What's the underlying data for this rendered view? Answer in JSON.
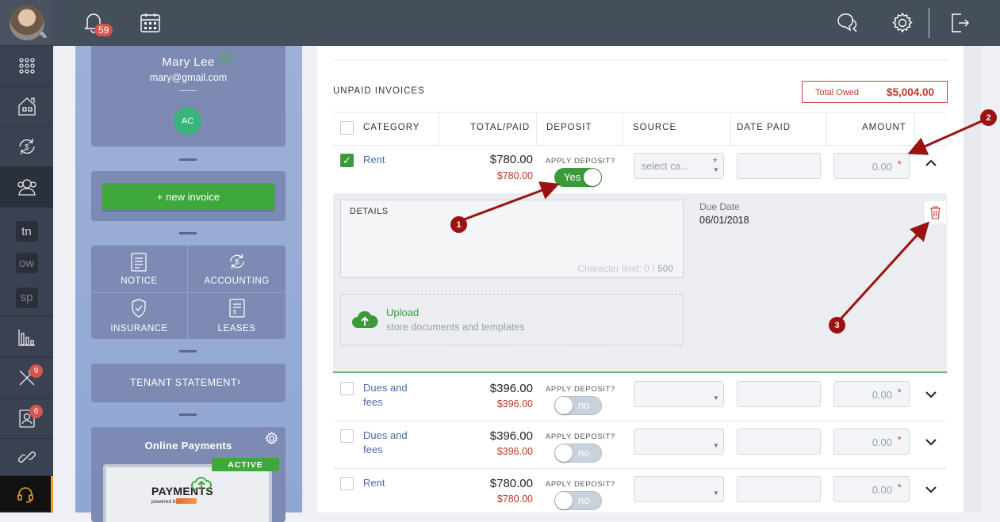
{
  "topbar": {
    "notification_count": "59"
  },
  "rail": {
    "labels": [
      "tn",
      "ow",
      "sp"
    ],
    "badges": {
      "tools": "9",
      "contacts": "6"
    }
  },
  "profile": {
    "name": "Mary Lee",
    "email": "mary@gmail.com",
    "initials": "AC"
  },
  "sidebar": {
    "new_invoice_label": "+ new invoice",
    "quick_links": [
      "NOTICE",
      "ACCOUNTING",
      "INSURANCE",
      "LEASES"
    ],
    "tenant_statement_label": "TENANT STATEMENT",
    "online_payments_title": "Online Payments",
    "active_badge": "ACTIVE",
    "payments_logo_text": "PAYMENTS",
    "payments_powered_by": "powered by"
  },
  "invoices": {
    "section_title": "UNPAID INVOICES",
    "total_owed_label": "Total Owed",
    "total_owed_value": "$5,004.00",
    "columns": [
      "CATEGORY",
      "TOTAL/PAID",
      "DEPOSIT",
      "SOURCE",
      "DATE PAID",
      "AMOUNT"
    ],
    "apply_deposit_label": "APPLY DEPOSIT?",
    "rows": [
      {
        "category": "Rent",
        "total": "$780.00",
        "paid": "$780.00",
        "deposit": "Yes",
        "source_placeholder": "select ca...",
        "amount_placeholder": "0.00",
        "checked": true,
        "expanded": true
      },
      {
        "category": "Dues and fees",
        "total": "$396.00",
        "paid": "$396.00",
        "deposit": "no",
        "amount_placeholder": "0.00",
        "checked": false
      },
      {
        "category": "Dues and fees",
        "total": "$396.00",
        "paid": "$396.00",
        "deposit": "no",
        "amount_placeholder": "0.00",
        "checked": false
      },
      {
        "category": "Rent",
        "total": "$780.00",
        "paid": "$780.00",
        "deposit": "no",
        "amount_placeholder": "0.00",
        "checked": false
      }
    ],
    "details": {
      "label": "DETAILS",
      "char_limit_prefix": "Character limit: 0 / ",
      "char_limit_max": "500",
      "due_date_label": "Due Date",
      "due_date_value": "06/01/2018",
      "upload_title": "Upload",
      "upload_subtitle": "store documents and templates"
    }
  },
  "callouts": [
    "1",
    "2",
    "3"
  ],
  "colors": {
    "accent_green": "#3d9a3b",
    "dark_red": "#9c1111",
    "price_red": "#c0392b",
    "link_blue": "#4a6ca8"
  }
}
